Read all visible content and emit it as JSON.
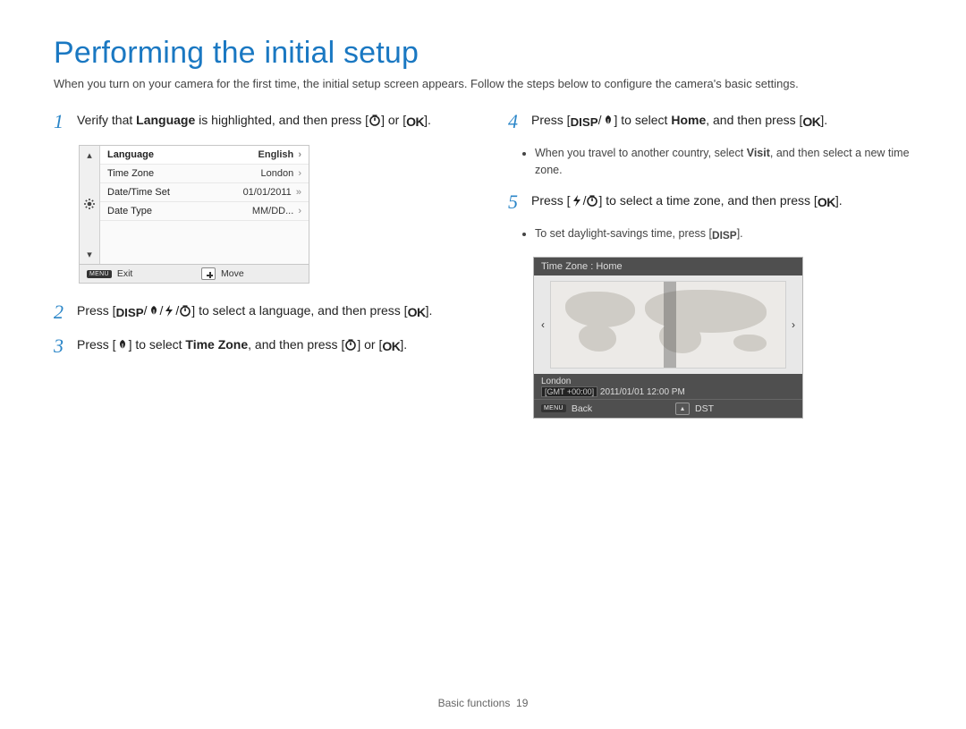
{
  "title": "Performing the initial setup",
  "intro": "When you turn on your camera for the first time, the initial setup screen appears. Follow the steps below to configure the camera's basic settings.",
  "glyph": {
    "disp": "DISP",
    "ok": "OK",
    "menu": "MENU"
  },
  "steps": {
    "s1": {
      "num": "1",
      "pre": "Verify that ",
      "bold": "Language",
      "post": " is highlighted, and then press [",
      "tail": "] or ["
    },
    "s2": {
      "num": "2",
      "pre": "Press [",
      "post": "] to select a language, and then press ["
    },
    "s3": {
      "num": "3",
      "pre": "Press [",
      "mid": "] to select ",
      "bold": "Time Zone",
      "post": ", and then press [",
      "tail": "] or ["
    },
    "s4": {
      "num": "4",
      "pre": "Press [",
      "mid": "] to select ",
      "bold": "Home",
      "post": ", and then press ["
    },
    "s4sub": {
      "a_pre": "When you travel to another country, select ",
      "a_bold": "Visit",
      "a_post": ", and then select a new time zone."
    },
    "s5": {
      "num": "5",
      "pre": "Press [",
      "post": "] to select a time zone, and then press ["
    },
    "s5sub": {
      "a_pre": "To set daylight-savings time, press [",
      "a_post": "]."
    }
  },
  "camScreen": {
    "rows": [
      {
        "label": "Language",
        "value": "English",
        "hl": true
      },
      {
        "label": "Time Zone",
        "value": "London",
        "hl": false
      },
      {
        "label": "Date/Time Set",
        "value": "01/01/2011",
        "hl": false
      },
      {
        "label": "Date Type",
        "value": "MM/DD...",
        "hl": false
      }
    ],
    "foot": {
      "exit": "Exit",
      "move": "Move"
    }
  },
  "tzScreen": {
    "title": "Time Zone : Home",
    "city": "London",
    "gmt": "[GMT +00:00]",
    "datetime": "2011/01/01 12:00 PM",
    "foot": {
      "back": "Back",
      "dst": "DST"
    }
  },
  "footer": {
    "section": "Basic functions",
    "page": "19"
  }
}
